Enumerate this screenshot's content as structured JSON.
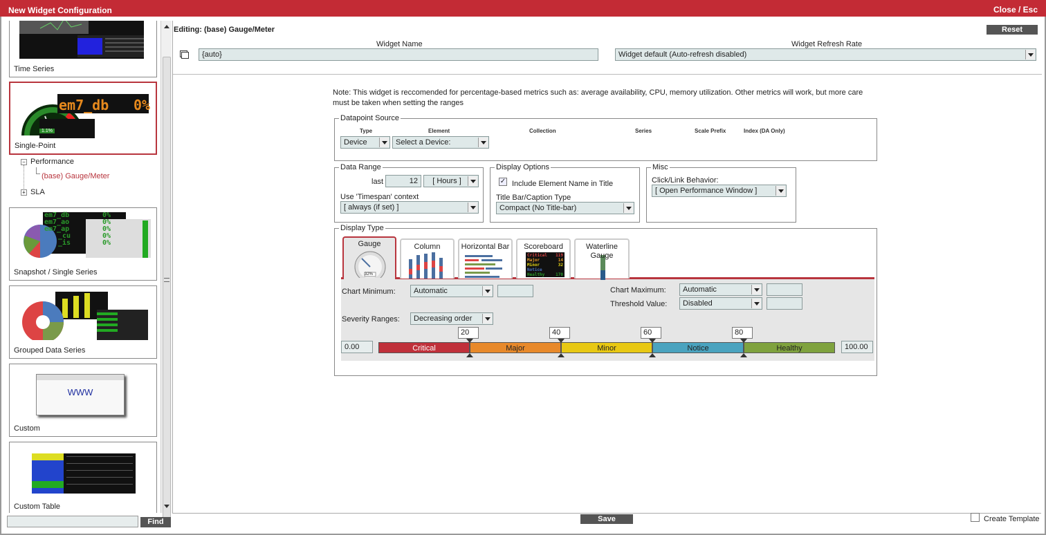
{
  "window": {
    "title": "New Widget Configuration",
    "close_label": "Close / Esc"
  },
  "sidebar": {
    "cards": [
      {
        "label": "Time Series"
      },
      {
        "label": "Single-Point"
      },
      {
        "label": "Snapshot / Single Series"
      },
      {
        "label": "Grouped Data Series"
      },
      {
        "label": "Custom"
      },
      {
        "label": "Custom Table"
      }
    ],
    "single_point_thumb": {
      "name": "em7_db",
      "value": "0%",
      "gauge_value": "1.1%"
    },
    "snapshot_thumb": {
      "rows": [
        "em7_db",
        "em7_ao",
        "em7_ap",
        "_cu",
        "_is"
      ],
      "pct": "0%"
    },
    "custom_thumb": {
      "text": "WWW"
    },
    "tree": {
      "performance": "Performance",
      "selected": "(base) Gauge/Meter",
      "sla": "SLA"
    },
    "find_placeholder": "",
    "find_label": "Find"
  },
  "editor": {
    "title": "Editing: (base) Gauge/Meter",
    "reset_label": "Reset",
    "widget_name_label": "Widget Name",
    "widget_name_value": "{auto}",
    "refresh_label": "Widget Refresh Rate",
    "refresh_value": "Widget default (Auto-refresh disabled)",
    "note": "Note: This widget is reccomended for percentage-based metrics such as: average availability, CPU, memory utilization. Other metrics will work, but more care must be taken when setting the ranges",
    "datapoint": {
      "legend": "Datapoint Source",
      "headers": {
        "type": "Type",
        "element": "Element",
        "collection": "Collection",
        "series": "Series",
        "scale": "Scale Prefix",
        "index": "Index (DA Only)"
      },
      "type_value": "Device",
      "element_value": "Select a Device:"
    },
    "data_range": {
      "legend": "Data Range",
      "last_label": "last",
      "last_value": "12",
      "unit_value": "[ Hours ]",
      "timespan_label": "Use 'Timespan' context",
      "timespan_value": "[ always (if set) ]"
    },
    "display_options": {
      "legend": "Display Options",
      "include_label": "Include Element Name in Title",
      "include_checked": true,
      "titlebar_label": "Title Bar/Caption Type",
      "titlebar_value": "Compact (No Title-bar)"
    },
    "misc": {
      "legend": "Misc",
      "click_label": "Click/Link Behavior:",
      "click_value": "[ Open Performance Window ]"
    },
    "display_type": {
      "legend": "Display Type",
      "tabs": [
        "Gauge",
        "Column",
        "Horizontal Bar",
        "Scoreboard",
        "Waterline Gauge"
      ],
      "scoreboard_rows": [
        "Critical",
        "Major",
        "Minor",
        "Notice",
        "Healthy"
      ],
      "scoreboard_vals": [
        "119",
        "14",
        "32",
        "",
        "170"
      ],
      "gauge_value": "32%",
      "chart_min_label": "Chart Minimum:",
      "chart_min_value": "Automatic",
      "chart_max_label": "Chart Maximum:",
      "chart_max_value": "Automatic",
      "threshold_label": "Threshold Value:",
      "threshold_value": "Disabled",
      "severity_label": "Severity Ranges:",
      "severity_value": "Decreasing order",
      "range_min": "0.00",
      "range_max": "100.00",
      "markers": [
        "20",
        "40",
        "60",
        "80"
      ],
      "segments": [
        {
          "label": "Critical",
          "color": "#c0303a"
        },
        {
          "label": "Major",
          "color": "#e8892a"
        },
        {
          "label": "Minor",
          "color": "#e8c813"
        },
        {
          "label": "Notice",
          "color": "#4aa3bf"
        },
        {
          "label": "Healthy",
          "color": "#7fa23e"
        }
      ]
    }
  },
  "footer": {
    "save_label": "Save",
    "create_template_label": "Create Template"
  }
}
